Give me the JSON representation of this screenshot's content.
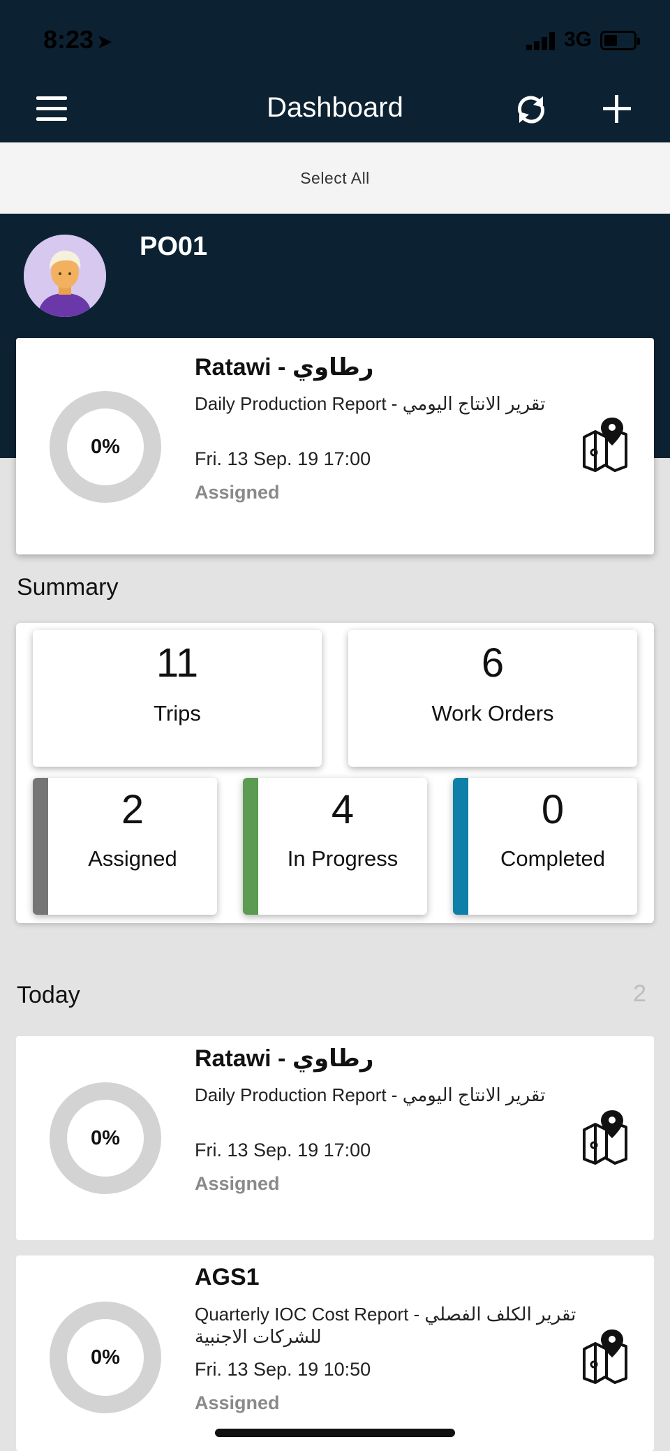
{
  "status_bar": {
    "time": "8:23",
    "network": "3G"
  },
  "nav": {
    "title": "Dashboard"
  },
  "select_all": {
    "label": "Select All"
  },
  "profile": {
    "name": "PO01"
  },
  "featured_task": {
    "progress": "0%",
    "title": "Ratawi - رطاوي",
    "description": "Daily Production Report - تقرير الانتاج اليومي",
    "datetime": "Fri. 13 Sep. 19 17:00",
    "status": "Assigned"
  },
  "summary": {
    "title": "Summary",
    "trips": {
      "value": "11",
      "label": "Trips"
    },
    "work_orders": {
      "value": "6",
      "label": "Work Orders"
    },
    "assigned": {
      "value": "2",
      "label": "Assigned",
      "color": "#757575"
    },
    "in_progress": {
      "value": "4",
      "label": "In Progress",
      "color": "#5c9b52"
    },
    "completed": {
      "value": "0",
      "label": "Completed",
      "color": "#0e7fa6"
    }
  },
  "today": {
    "title": "Today",
    "count": "2",
    "tasks": [
      {
        "progress": "0%",
        "title": "Ratawi - رطاوي",
        "description": "Daily Production Report - تقرير الانتاج اليومي",
        "datetime": "Fri. 13 Sep. 19 17:00",
        "status": "Assigned"
      },
      {
        "progress": "0%",
        "title": "AGS1",
        "description": "Quarterly IOC Cost Report - تقرير الكلف الفصلي للشركات الاجنبية",
        "datetime": "Fri. 13 Sep. 19 10:50",
        "status": "Assigned"
      }
    ]
  },
  "colors": {
    "header": "#0c2233",
    "background": "#e3e3e3",
    "status_muted": "#8a8a8a"
  }
}
